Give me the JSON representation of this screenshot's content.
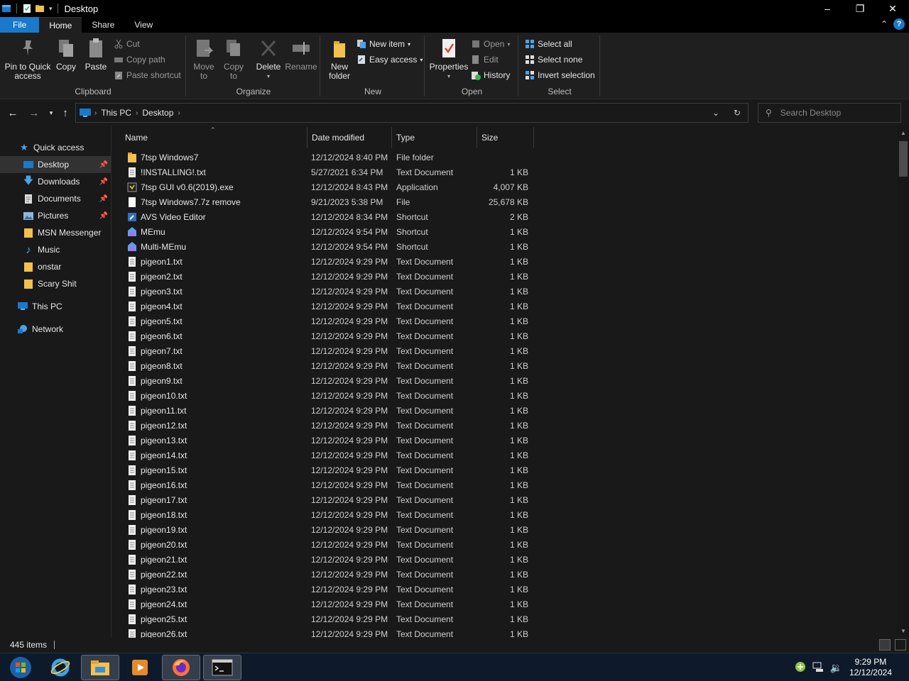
{
  "window": {
    "title": "Desktop"
  },
  "ribbon_tabs": [
    "File",
    "Home",
    "Share",
    "View"
  ],
  "ribbon": {
    "clipboard": {
      "label": "Clipboard",
      "pin_line1": "Pin to Quick",
      "pin_line2": "access",
      "copy": "Copy",
      "paste": "Paste",
      "cut": "Cut",
      "copy_path": "Copy path",
      "paste_shortcut": "Paste shortcut"
    },
    "organize": {
      "label": "Organize",
      "move_line1": "Move",
      "move_line2": "to",
      "copy_line1": "Copy",
      "copy_line2": "to",
      "delete": "Delete",
      "rename": "Rename"
    },
    "new": {
      "label": "New",
      "new_folder_line1": "New",
      "new_folder_line2": "folder",
      "new_item": "New item",
      "easy_access": "Easy access"
    },
    "open": {
      "label": "Open",
      "properties": "Properties",
      "open": "Open",
      "edit": "Edit",
      "history": "History"
    },
    "select": {
      "label": "Select",
      "select_all": "Select all",
      "select_none": "Select none",
      "invert_selection": "Invert selection"
    }
  },
  "address": {
    "crumbs": [
      "This PC",
      "Desktop"
    ],
    "search_placeholder": "Search Desktop"
  },
  "nav": [
    {
      "label": "Quick access",
      "type": "header",
      "pinned": false
    },
    {
      "label": "Desktop",
      "type": "child",
      "pinned": true,
      "selected": true
    },
    {
      "label": "Downloads",
      "type": "child",
      "pinned": true
    },
    {
      "label": "Documents",
      "type": "child",
      "pinned": true
    },
    {
      "label": "Pictures",
      "type": "child",
      "pinned": true
    },
    {
      "label": "MSN Messenger",
      "type": "child",
      "pinned": false
    },
    {
      "label": "Music",
      "type": "child",
      "pinned": false
    },
    {
      "label": "onstar",
      "type": "child",
      "pinned": false
    },
    {
      "label": "Scary Shit",
      "type": "child",
      "pinned": false
    },
    {
      "label": "This PC",
      "type": "header",
      "pinned": false
    },
    {
      "label": "Network",
      "type": "header",
      "pinned": false
    }
  ],
  "columns": {
    "name": "Name",
    "date": "Date modified",
    "type": "Type",
    "size": "Size"
  },
  "files": [
    {
      "name": "7tsp Windows7",
      "date": "12/12/2024 8:40 PM",
      "type": "File folder",
      "size": "",
      "icon": "folder"
    },
    {
      "name": "!INSTALLING!.txt",
      "date": "5/27/2021 6:34 PM",
      "type": "Text Document",
      "size": "1 KB",
      "icon": "text"
    },
    {
      "name": "7tsp GUI v0.6(2019).exe",
      "date": "12/12/2024 8:43 PM",
      "type": "Application",
      "size": "4,007 KB",
      "icon": "app"
    },
    {
      "name": "7tsp Windows7.7z remove",
      "date": "9/21/2023 5:38 PM",
      "type": "File",
      "size": "25,678 KB",
      "icon": "file"
    },
    {
      "name": "AVS Video Editor",
      "date": "12/12/2024 8:34 PM",
      "type": "Shortcut",
      "size": "2 KB",
      "icon": "shortcut"
    },
    {
      "name": "MEmu",
      "date": "12/12/2024 9:54 PM",
      "type": "Shortcut",
      "size": "1 KB",
      "icon": "memu"
    },
    {
      "name": "Multi-MEmu",
      "date": "12/12/2024 9:54 PM",
      "type": "Shortcut",
      "size": "1 KB",
      "icon": "memu"
    },
    {
      "name": "pigeon1.txt",
      "date": "12/12/2024 9:29 PM",
      "type": "Text Document",
      "size": "1 KB",
      "icon": "text"
    },
    {
      "name": "pigeon2.txt",
      "date": "12/12/2024 9:29 PM",
      "type": "Text Document",
      "size": "1 KB",
      "icon": "text"
    },
    {
      "name": "pigeon3.txt",
      "date": "12/12/2024 9:29 PM",
      "type": "Text Document",
      "size": "1 KB",
      "icon": "text"
    },
    {
      "name": "pigeon4.txt",
      "date": "12/12/2024 9:29 PM",
      "type": "Text Document",
      "size": "1 KB",
      "icon": "text"
    },
    {
      "name": "pigeon5.txt",
      "date": "12/12/2024 9:29 PM",
      "type": "Text Document",
      "size": "1 KB",
      "icon": "text"
    },
    {
      "name": "pigeon6.txt",
      "date": "12/12/2024 9:29 PM",
      "type": "Text Document",
      "size": "1 KB",
      "icon": "text"
    },
    {
      "name": "pigeon7.txt",
      "date": "12/12/2024 9:29 PM",
      "type": "Text Document",
      "size": "1 KB",
      "icon": "text"
    },
    {
      "name": "pigeon8.txt",
      "date": "12/12/2024 9:29 PM",
      "type": "Text Document",
      "size": "1 KB",
      "icon": "text"
    },
    {
      "name": "pigeon9.txt",
      "date": "12/12/2024 9:29 PM",
      "type": "Text Document",
      "size": "1 KB",
      "icon": "text"
    },
    {
      "name": "pigeon10.txt",
      "date": "12/12/2024 9:29 PM",
      "type": "Text Document",
      "size": "1 KB",
      "icon": "text"
    },
    {
      "name": "pigeon11.txt",
      "date": "12/12/2024 9:29 PM",
      "type": "Text Document",
      "size": "1 KB",
      "icon": "text"
    },
    {
      "name": "pigeon12.txt",
      "date": "12/12/2024 9:29 PM",
      "type": "Text Document",
      "size": "1 KB",
      "icon": "text"
    },
    {
      "name": "pigeon13.txt",
      "date": "12/12/2024 9:29 PM",
      "type": "Text Document",
      "size": "1 KB",
      "icon": "text"
    },
    {
      "name": "pigeon14.txt",
      "date": "12/12/2024 9:29 PM",
      "type": "Text Document",
      "size": "1 KB",
      "icon": "text"
    },
    {
      "name": "pigeon15.txt",
      "date": "12/12/2024 9:29 PM",
      "type": "Text Document",
      "size": "1 KB",
      "icon": "text"
    },
    {
      "name": "pigeon16.txt",
      "date": "12/12/2024 9:29 PM",
      "type": "Text Document",
      "size": "1 KB",
      "icon": "text"
    },
    {
      "name": "pigeon17.txt",
      "date": "12/12/2024 9:29 PM",
      "type": "Text Document",
      "size": "1 KB",
      "icon": "text"
    },
    {
      "name": "pigeon18.txt",
      "date": "12/12/2024 9:29 PM",
      "type": "Text Document",
      "size": "1 KB",
      "icon": "text"
    },
    {
      "name": "pigeon19.txt",
      "date": "12/12/2024 9:29 PM",
      "type": "Text Document",
      "size": "1 KB",
      "icon": "text"
    },
    {
      "name": "pigeon20.txt",
      "date": "12/12/2024 9:29 PM",
      "type": "Text Document",
      "size": "1 KB",
      "icon": "text"
    },
    {
      "name": "pigeon21.txt",
      "date": "12/12/2024 9:29 PM",
      "type": "Text Document",
      "size": "1 KB",
      "icon": "text"
    },
    {
      "name": "pigeon22.txt",
      "date": "12/12/2024 9:29 PM",
      "type": "Text Document",
      "size": "1 KB",
      "icon": "text"
    },
    {
      "name": "pigeon23.txt",
      "date": "12/12/2024 9:29 PM",
      "type": "Text Document",
      "size": "1 KB",
      "icon": "text"
    },
    {
      "name": "pigeon24.txt",
      "date": "12/12/2024 9:29 PM",
      "type": "Text Document",
      "size": "1 KB",
      "icon": "text"
    },
    {
      "name": "pigeon25.txt",
      "date": "12/12/2024 9:29 PM",
      "type": "Text Document",
      "size": "1 KB",
      "icon": "text"
    },
    {
      "name": "pigeon26.txt",
      "date": "12/12/2024 9:29 PM",
      "type": "Text Document",
      "size": "1 KB",
      "icon": "text"
    }
  ],
  "status": {
    "item_count": "445 items"
  },
  "taskbar": {
    "apps": [
      "start-orb-icon",
      "internet-explorer-icon",
      "file-explorer-icon",
      "media-player-icon",
      "firefox-icon",
      "command-prompt-icon"
    ],
    "clock_time": "9:29 PM",
    "clock_date": "12/12/2024"
  },
  "colors": {
    "accent": "#1979ca",
    "background": "#191919",
    "ribbon": "#1f1f1f",
    "folder": "#f2c14e"
  }
}
